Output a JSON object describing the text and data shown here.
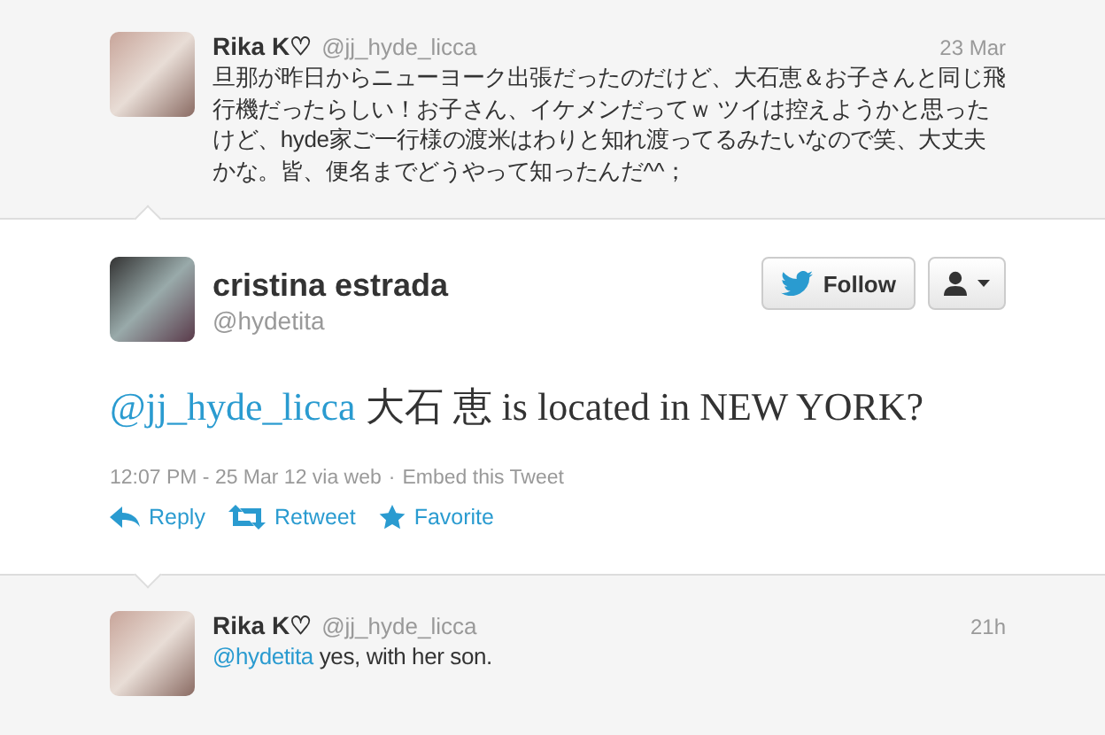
{
  "previous_tweet": {
    "name": "Rika K♡",
    "handle": "@jj_hyde_licca",
    "time": "23 Mar",
    "text": "旦那が昨日からニューヨーク出張だったのだけど、大石恵＆お子さんと同じ飛行機だったらしい！お子さん、イケメンだってｗ ツイは控えようかと思ったけど、hyde家ご一行様の渡米はわりと知れ渡ってるみたいなので笑、大丈夫かな。皆、便名までどうやって知ったんだ^^；"
  },
  "main_tweet": {
    "name": "cristina estrada",
    "handle": "@hydetita",
    "follow_button": "Follow",
    "mention": "@jj_hyde_licca",
    "text": "大石 恵 is located in NEW YORK?",
    "timestamp": "12:07 PM - 25 Mar 12 via web",
    "separator": "·",
    "embed_link": "Embed this Tweet",
    "actions": [
      {
        "kind": "reply",
        "label": "Reply"
      },
      {
        "kind": "retweet",
        "label": "Retweet"
      },
      {
        "kind": "favorite",
        "label": "Favorite"
      }
    ]
  },
  "reply_tweet": {
    "name": "Rika K♡",
    "handle": "@jj_hyde_licca",
    "time": "21h",
    "mention": "@hydetita",
    "text": "yes, with her son."
  }
}
